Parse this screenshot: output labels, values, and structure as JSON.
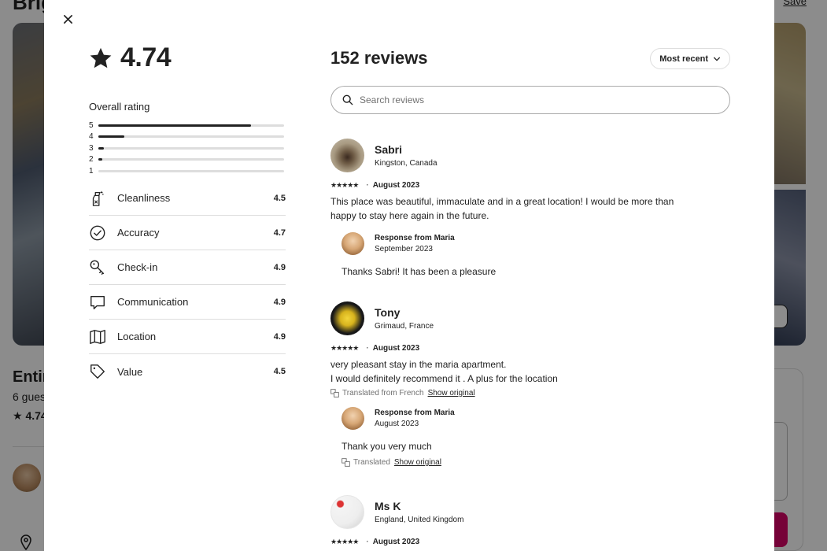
{
  "background": {
    "title": "Brig",
    "save": "Save",
    "listing_title": "Entir",
    "guests": "6 gues",
    "rating": "★ 4.74"
  },
  "modal": {
    "overall_score": "4.74",
    "overall_label": "Overall rating",
    "distribution": [
      {
        "stars": "5",
        "fraction": 0.82
      },
      {
        "stars": "4",
        "fraction": 0.14
      },
      {
        "stars": "3",
        "fraction": 0.03
      },
      {
        "stars": "2",
        "fraction": 0.02
      },
      {
        "stars": "1",
        "fraction": 0.0
      }
    ],
    "categories": [
      {
        "label": "Cleanliness",
        "score": "4.5",
        "icon": "spray-bottle-icon"
      },
      {
        "label": "Accuracy",
        "score": "4.7",
        "icon": "check-circle-icon"
      },
      {
        "label": "Check-in",
        "score": "4.9",
        "icon": "key-icon"
      },
      {
        "label": "Communication",
        "score": "4.9",
        "icon": "chat-bubble-icon"
      },
      {
        "label": "Location",
        "score": "4.9",
        "icon": "map-icon"
      },
      {
        "label": "Value",
        "score": "4.5",
        "icon": "tag-icon"
      }
    ],
    "reviews_title": "152 reviews",
    "sort_label": "Most recent",
    "search_placeholder": "Search reviews",
    "reviews": [
      {
        "name": "Sabri",
        "location": "Kingston, Canada",
        "stars": "★★★★★",
        "date": "August 2023",
        "text_lines": [
          "This place was beautiful, immaculate and in a great location! I would be more than",
          "happy to stay here again in the future."
        ],
        "response": {
          "from": "Response from Maria",
          "date": "September 2023",
          "text": "Thanks Sabri! It has been a pleasure"
        }
      },
      {
        "name": "Tony",
        "location": "Grimaud, France",
        "stars": "★★★★★",
        "date": "August 2023",
        "text_lines": [
          "very pleasant stay in the maria apartment.",
          "I would definitely recommend it . A plus for the location"
        ],
        "translated": "Translated from French",
        "show_original": "Show original",
        "response": {
          "from": "Response from Maria",
          "date": "August 2023",
          "text": "Thank you very much",
          "translated": "Translated",
          "show_original": "Show original"
        }
      },
      {
        "name": "Ms K",
        "location": "England, United Kingdom",
        "stars": "★★★★★",
        "date": "August 2023"
      }
    ]
  }
}
